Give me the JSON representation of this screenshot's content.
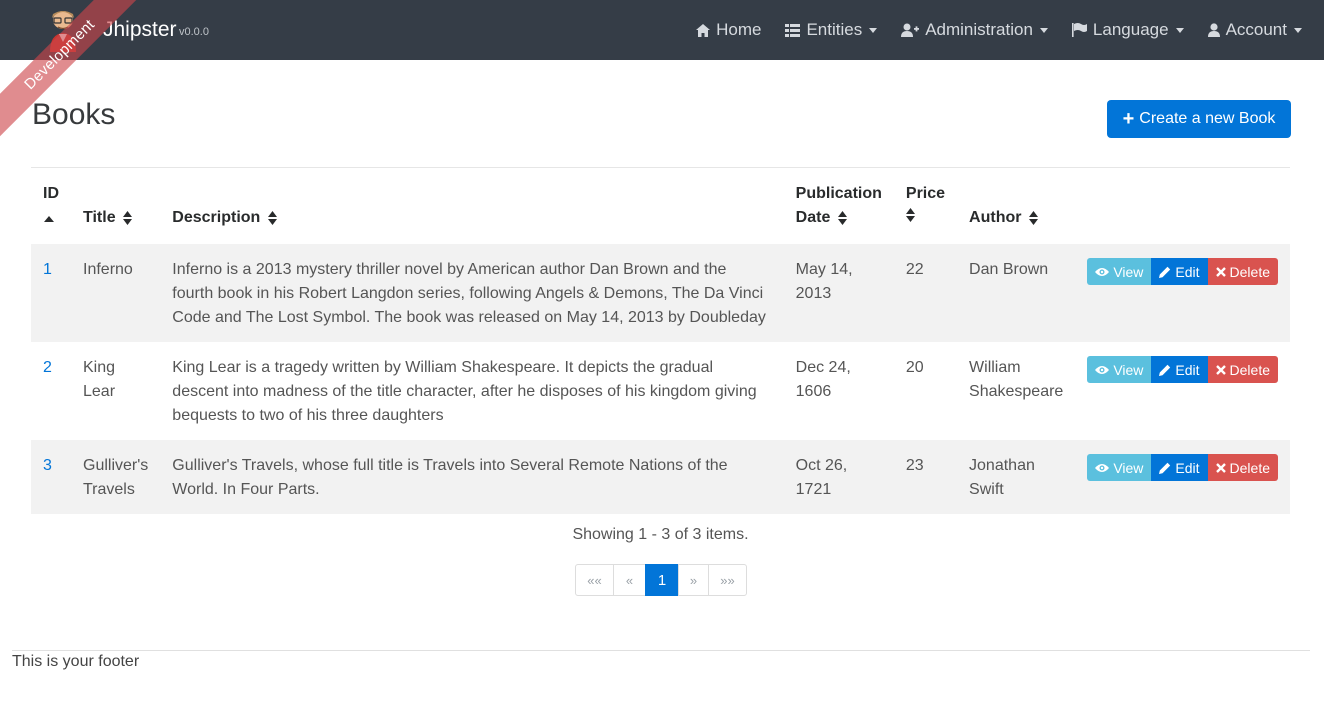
{
  "navbar": {
    "brand_name": "Jhipster",
    "brand_version": "v0.0.0",
    "ribbon": "Development",
    "items": [
      {
        "label": "Home",
        "icon": "home-icon"
      },
      {
        "label": "Entities",
        "icon": "th-list-icon"
      },
      {
        "label": "Administration",
        "icon": "user-plus-icon"
      },
      {
        "label": "Language",
        "icon": "flag-icon"
      },
      {
        "label": "Account",
        "icon": "user-icon"
      }
    ]
  },
  "page": {
    "title": "Books",
    "create_label": "Create a new Book"
  },
  "table": {
    "headers": {
      "id": "ID",
      "title": "Title",
      "description": "Description",
      "publication_date_1": "Publication",
      "publication_date_2": "Date",
      "price": "Price",
      "author": "Author"
    },
    "rows": [
      {
        "id": "1",
        "title": "Inferno",
        "description": "Inferno is a 2013 mystery thriller novel by American author Dan Brown and the fourth book in his Robert Langdon series, following Angels & Demons, The Da Vinci Code and The Lost Symbol. The book was released on May 14, 2013 by Doubleday",
        "date": "May 14, 2013",
        "price": "22",
        "author": "Dan Brown"
      },
      {
        "id": "2",
        "title": "King Lear",
        "description": "King Lear is a tragedy written by William Shakespeare. It depicts the gradual descent into madness of the title character, after he disposes of his kingdom giving bequests to two of his three daughters",
        "date": "Dec 24, 1606",
        "price": "20",
        "author": "William Shakespeare"
      },
      {
        "id": "3",
        "title": "Gulliver's Travels",
        "description": "Gulliver's Travels, whose full title is Travels into Several Remote Nations of the World. In Four Parts.",
        "date": "Oct 26, 1721",
        "price": "23",
        "author": "Jonathan Swift"
      }
    ],
    "actions": {
      "view": "View",
      "edit": "Edit",
      "delete": "Delete"
    }
  },
  "pagination": {
    "showing": "Showing 1 - 3 of 3 items.",
    "first": "««",
    "prev": "«",
    "current": "1",
    "next": "»",
    "last": "»»"
  },
  "footer": {
    "text": "This is your footer"
  },
  "colors": {
    "navbar": "#353d47",
    "primary": "#0275d8",
    "info": "#5bc0de",
    "danger": "#d9534f",
    "ribbon": "#cd464b"
  }
}
